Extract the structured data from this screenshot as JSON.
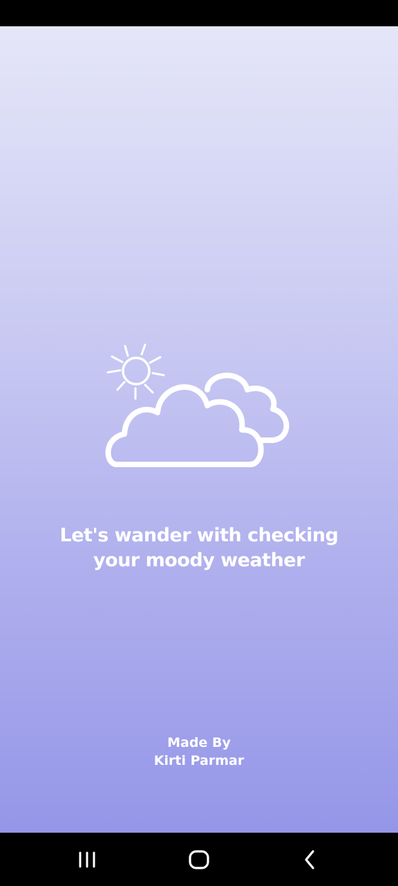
{
  "splash": {
    "tagline_line1": "Let's wander with checking",
    "tagline_line2": "your moody weather",
    "credit_line1": "Made By",
    "credit_line2": "Kirti Parmar",
    "illustration_icon": "partly-cloudy-sun-icon"
  },
  "navigation": {
    "recent_icon": "recent-apps-icon",
    "home_icon": "home-icon",
    "back_icon": "back-icon"
  },
  "colors": {
    "gradient_top": "#e5e6f8",
    "gradient_bottom": "#9596e8",
    "text": "#ffffff",
    "system_bars": "#000000"
  }
}
